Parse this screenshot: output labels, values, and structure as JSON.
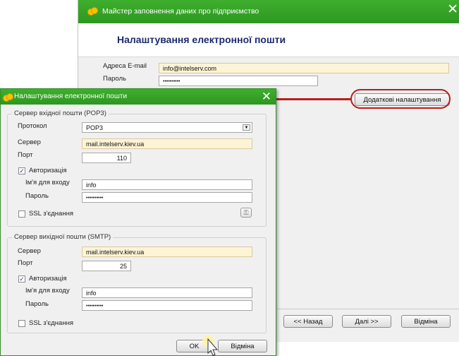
{
  "wizard": {
    "title": "Майстер заповнення даних про підприємство",
    "close_glyph": "✕",
    "header_title": "Налаштування електронної пошти",
    "email_label": "Адреса E-mail",
    "email_value": "info@intelserv.com",
    "password_label": "Пароль",
    "password_value": "••••••••••",
    "advanced_button": "Додаткові налаштування",
    "back_button": "<< Назад",
    "next_button": "Далі >>",
    "cancel_button": "Відміна"
  },
  "dialog": {
    "title": "Налаштування електронної пошти",
    "close_glyph": "✕",
    "incoming": {
      "group_title": "Сервер вхідної пошти (POP3)",
      "protocol_label": "Протокол",
      "protocol_value": "POP3",
      "server_label": "Сервер",
      "server_value": "mail.intelserv.kiev.ua",
      "port_label": "Порт",
      "port_value": "110",
      "auth_label": "Авторизація",
      "auth_checked": true,
      "login_label": "Ім'я для входу",
      "login_value": "info",
      "password_label": "Пароль",
      "password_value": "••••••••••",
      "ssl_label": "SSL з'єднання",
      "ssl_checked": false
    },
    "outgoing": {
      "group_title": "Сервер вихідної пошти (SMTP)",
      "server_label": "Сервер",
      "server_value": "mail.intelserv.kiev.ua",
      "port_label": "Порт",
      "port_value": "25",
      "auth_label": "Авторизація",
      "auth_checked": true,
      "login_label": "Ім'я для входу",
      "login_value": "info",
      "password_label": "Пароль",
      "password_value": "••••••••••",
      "ssl_label": "SSL з'єднання",
      "ssl_checked": false
    },
    "ok_button": "OK",
    "cancel_button": "Відміна"
  },
  "colors": {
    "titlebar_green": "#2c9820",
    "header_title_blue": "#1d2a6d",
    "required_field_bg": "#fdf4d6",
    "annotation_red": "#b91d1d"
  },
  "icons": {
    "app": "app-logo-icon",
    "close": "close-icon",
    "dropdown": "chevron-down-icon",
    "check": "check-icon",
    "keys": "key-icon",
    "cursor": "mouse-pointer-icon"
  }
}
